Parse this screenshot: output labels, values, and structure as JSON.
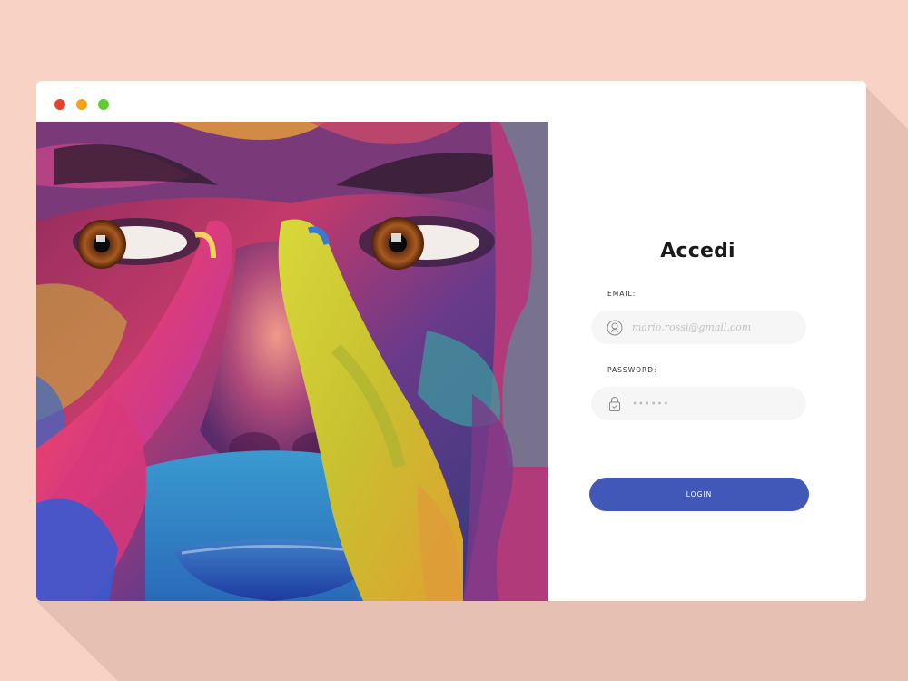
{
  "colors": {
    "background": "#f8d3c5",
    "accent": "#4158b8",
    "window": "#ffffff",
    "dot_close": "#e8412b",
    "dot_minimize": "#f5a316",
    "dot_maximize": "#5fcb2f"
  },
  "window": {
    "controls": [
      "close",
      "minimize",
      "maximize"
    ]
  },
  "hero": {
    "image_subject": "face painted with vivid multicolor paint, fingers over the eyes",
    "image_alt": ""
  },
  "login": {
    "title": "Accedi",
    "email_label": "EMAIL:",
    "email_placeholder": "mario.rossi@gmail.com",
    "email_value": "",
    "email_icon": "user-icon",
    "password_label": "PASSWORD:",
    "password_placeholder": "••••••",
    "password_value": "",
    "password_icon": "lock-icon",
    "submit_label": "LOGIN"
  }
}
